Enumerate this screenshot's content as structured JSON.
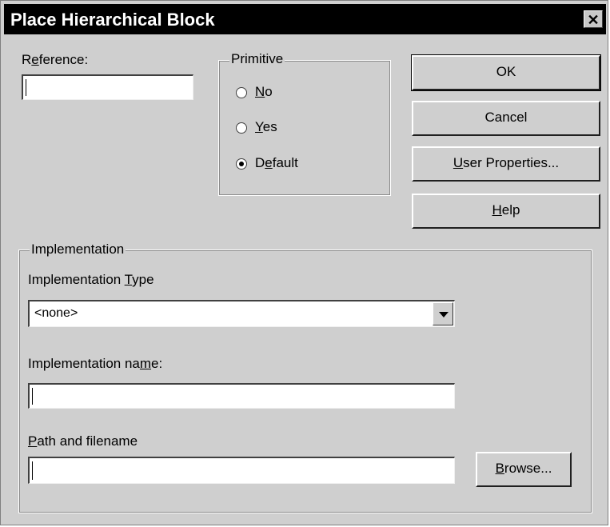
{
  "window": {
    "title": "Place Hierarchical Block",
    "close_glyph": "✕"
  },
  "reference": {
    "label_pre": "R",
    "label_u": "e",
    "label_post": "ference:",
    "value": ""
  },
  "primitive": {
    "title": "Primitive",
    "options": [
      {
        "pre": "",
        "u": "N",
        "post": "o",
        "checked": false
      },
      {
        "pre": "",
        "u": "Y",
        "post": "es",
        "checked": false
      },
      {
        "pre": "D",
        "u": "e",
        "post": "fault",
        "checked": true
      }
    ]
  },
  "buttons": {
    "ok": "OK",
    "cancel": "Cancel",
    "user_props_u": "U",
    "user_props_post": "ser Properties...",
    "help_u": "H",
    "help_post": "elp"
  },
  "implementation": {
    "title": "Implementation",
    "type_label_pre": "Implementation ",
    "type_label_u": "T",
    "type_label_post": "ype",
    "type_value": "<none>",
    "name_label_pre": "Implementation na",
    "name_label_u": "m",
    "name_label_post": "e:",
    "name_value": "",
    "path_label_u": "P",
    "path_label_post": "ath and filename",
    "path_value": "",
    "browse_u": "B",
    "browse_post": "rowse..."
  }
}
